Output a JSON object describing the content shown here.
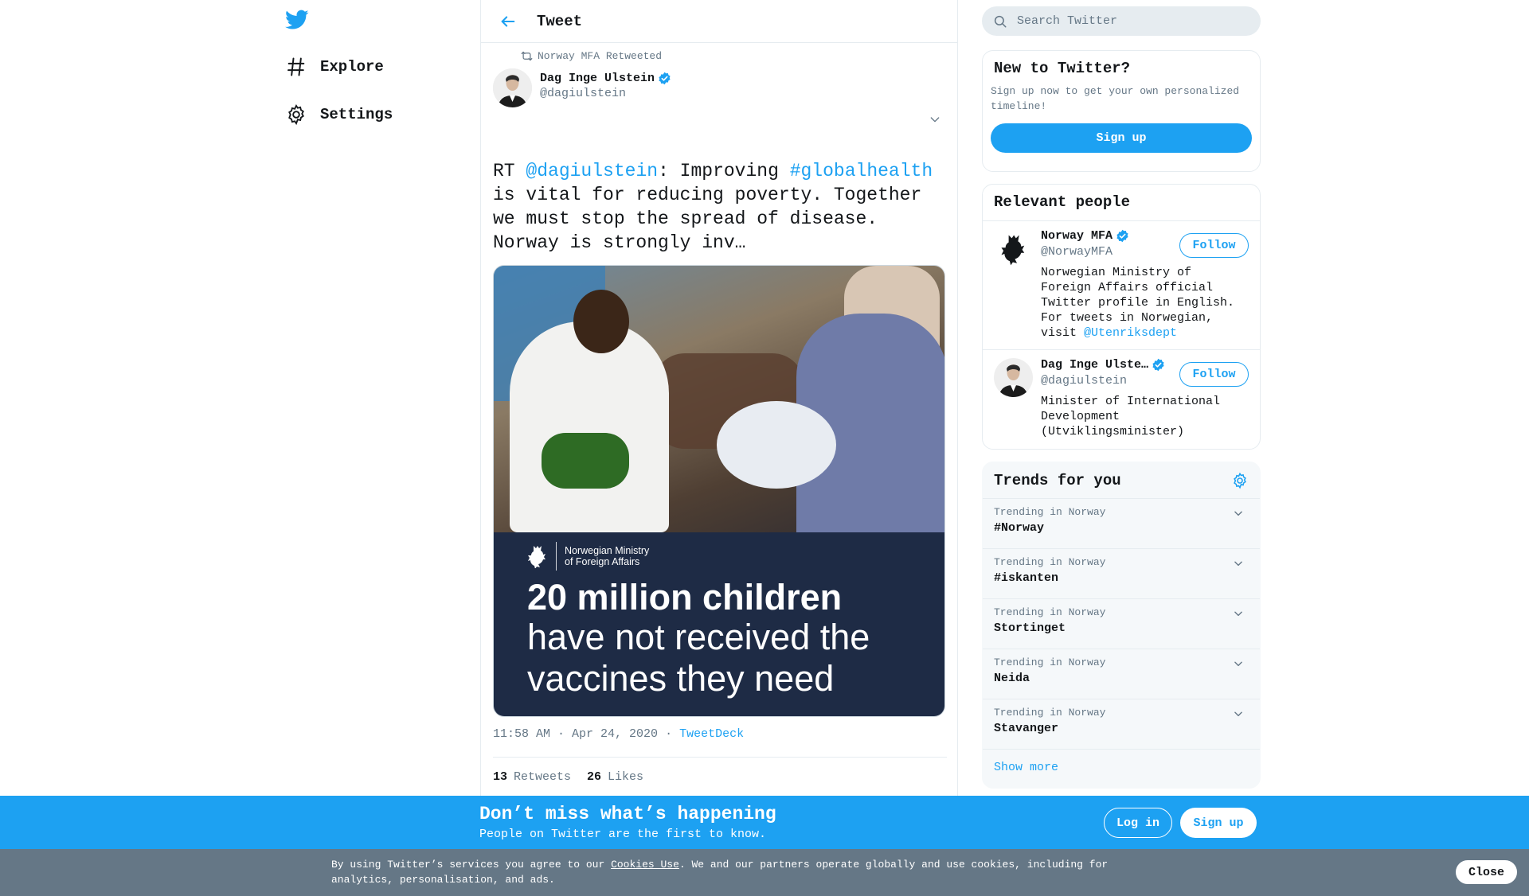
{
  "nav": {
    "logo_icon": "twitter-bird-icon",
    "items": [
      {
        "label": "Explore",
        "icon": "hashtag-icon"
      },
      {
        "label": "Settings",
        "icon": "gear-icon"
      }
    ]
  },
  "header": {
    "title": "Tweet",
    "back_icon": "arrow-left-icon"
  },
  "tweet": {
    "retweeted_by": "Norway MFA Retweeted",
    "author_name": "Dag Inge Ulstein",
    "author_handle": "@dagiulstein",
    "text_prefix": "RT ",
    "mention": "@dagiulstein",
    "text_mid": ": Improving ",
    "hashtag": "#globalhealth",
    "text_rest": " is vital for reducing poverty. Together we must stop the spread of disease. Norway is strongly inv…",
    "image": {
      "ministry_line": "Norwegian Ministry of Foreign Affairs",
      "headline": "20 million children",
      "subline": "have not received the vaccines they need"
    },
    "time": "11:58 AM · Apr 24, 2020",
    "separator": "·",
    "source": "TweetDeck",
    "retweets_count": "13",
    "retweets_label": "Retweets",
    "likes_count": "26",
    "likes_label": "Likes"
  },
  "search": {
    "placeholder": "Search Twitter"
  },
  "new_to_twitter": {
    "title": "New to Twitter?",
    "description": "Sign up now to get your own personalized timeline!",
    "button": "Sign up"
  },
  "relevant_people": {
    "title": "Relevant people",
    "people": [
      {
        "name": "Norway MFA",
        "handle": "@NorwayMFA",
        "bio": "Norwegian Ministry of Foreign Affairs official Twitter profile in English. For tweets in Norwegian, visit ",
        "bio_link": "@Utenriksdept",
        "follow": "Follow"
      },
      {
        "name": "Dag Inge Ulste…",
        "handle": "@dagiulstein",
        "bio": "Minister of International Development (Utviklingsminister)",
        "follow": "Follow"
      }
    ]
  },
  "trends": {
    "title": "Trends for you",
    "items": [
      {
        "context": "Trending in Norway",
        "name": "#Norway"
      },
      {
        "context": "Trending in Norway",
        "name": "#iskanten"
      },
      {
        "context": "Trending in Norway",
        "name": "Stortinget"
      },
      {
        "context": "Trending in Norway",
        "name": "Neida"
      },
      {
        "context": "Trending in Norway",
        "name": "Stavanger"
      }
    ],
    "show_more": "Show more"
  },
  "bottom_bar": {
    "title": "Don’t miss what’s happening",
    "subtitle": "People on Twitter are the first to know.",
    "login": "Log in",
    "signup": "Sign up"
  },
  "cookie": {
    "prefix": "By using Twitter’s services you agree to our ",
    "link": "Cookies Use",
    "suffix": ". We and our partners operate globally and use cookies, including for analytics, personalisation, and ads.",
    "close": "Close"
  },
  "colors": {
    "accent": "#1da1f2",
    "muted": "#657786",
    "cookie_bg": "#657786"
  }
}
